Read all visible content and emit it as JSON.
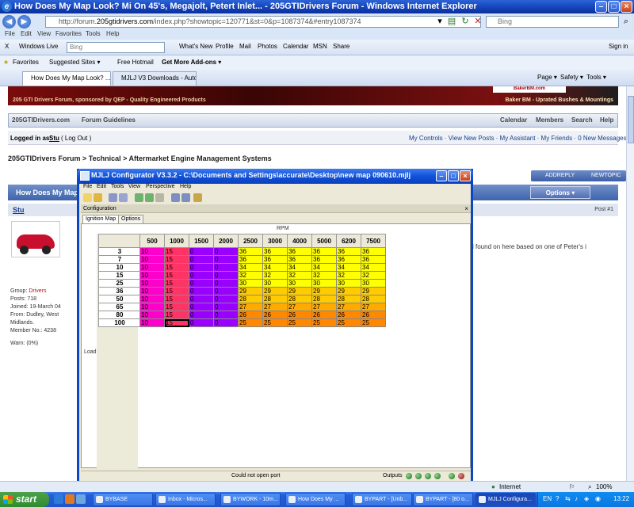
{
  "browser": {
    "title": "How Does My Map Look? Mi On 45's, Megajolt, Petert Inlet... - 205GTIDrivers Forum - Windows Internet Explorer",
    "url_prefix": "http://forum.",
    "url_domain": "205gtidrivers.com",
    "url_rest": "/index.php?showtopic=120771&st=0&p=1087374&#entry1087374",
    "search_placeholder": "Bing",
    "menu": [
      "File",
      "Edit",
      "View",
      "Favorites",
      "Tools",
      "Help"
    ],
    "links_bar": {
      "windows_live": "Windows Live",
      "search_placeholder": "Bing",
      "items": [
        "What's New",
        "Profile",
        "Mail",
        "Photos",
        "Calendar",
        "MSN",
        "Share"
      ],
      "sign_in": "Sign in"
    },
    "favorites_bar": {
      "favorites": "Favorites",
      "items": [
        "Suggested Sites ▾",
        "Free Hotmail",
        "Get More Add-ons ▾"
      ]
    },
    "tabs": [
      {
        "label": "How Does My Map Look? ..."
      },
      {
        "label": "MJLJ V3 Downloads - Autosp..."
      }
    ],
    "command_bar": [
      "Page ▾",
      "Safety ▾",
      "Tools ▾"
    ],
    "status": {
      "zone": "Internet",
      "zoom": "100%"
    }
  },
  "forum": {
    "banner_left": "205 GTI Drivers Forum, sponsored by QEP - Quality Engineered Products",
    "banner_right": "Baker BM - Uprated Bushes & Mountings",
    "banner_brand": "BakerBM.com",
    "nav_left": [
      "205GTIDrivers.com",
      "Forum Guidelines"
    ],
    "nav_right": [
      "Calendar",
      "Members",
      "Search",
      "Help"
    ],
    "login_prefix": "Logged in as:",
    "login_user": "Stu",
    "login_logout": "( Log Out )",
    "login_links": "My Controls · View New Posts · My Assistant · My Friends · 0 New Messages",
    "breadcrumb": "205GTIDrivers Forum > Technical > Aftermarket Engine Management Systems",
    "add_reply": "ADDREPLY",
    "new_topic": "NEWTOPIC",
    "topic_title": "How Does My Map",
    "options": "Options ▾",
    "post_author": "Stu",
    "post_number": "Post #1",
    "post_text": "i found on here based on one of Peter's i",
    "user_info": {
      "group_label": "Group:",
      "group": "Drivers",
      "posts": "Posts: 718",
      "joined": "Joined: 19-March 04",
      "from": "From: Dudley, West Midlands.",
      "member": "Member No.: 4238",
      "warn": "Warn: (0%)"
    }
  },
  "app": {
    "title": "MJLJ Configurator V3.3.2 - C:\\Documents and Settings\\accurate\\Desktop\\new map 090610.mjlj",
    "menu": [
      "File",
      "Edit",
      "Tools",
      "View",
      "Perspective",
      "Help"
    ],
    "panel_title": "Configuration",
    "panel_close": "×",
    "tabs": [
      "Ignition Map",
      "Options"
    ],
    "rpm_label": "RPM",
    "load_label": "Load",
    "status_msg": "Could not open port",
    "outputs_label": "Outputs"
  },
  "colors": {
    "magenta": "#ff00cc",
    "pink": "#ff3366",
    "violet": "#9900ff",
    "yellow": "#ffff00",
    "gold": "#ffcc00",
    "amber": "#ffaa00",
    "orange": "#ff8800"
  },
  "ignition_map": {
    "rpm": [
      "500",
      "1000",
      "1500",
      "2000",
      "2500",
      "3000",
      "4000",
      "5000",
      "6200",
      "7500"
    ],
    "load": [
      "3",
      "7",
      "10",
      "15",
      "25",
      "36",
      "50",
      "65",
      "80",
      "100"
    ],
    "values": [
      [
        "10",
        "15",
        "0",
        "0",
        "36",
        "36",
        "36",
        "36",
        "36",
        "36"
      ],
      [
        "10",
        "15",
        "0",
        "0",
        "36",
        "36",
        "36",
        "36",
        "36",
        "36"
      ],
      [
        "10",
        "15",
        "0",
        "0",
        "34",
        "34",
        "34",
        "34",
        "34",
        "34"
      ],
      [
        "10",
        "15",
        "0",
        "0",
        "32",
        "32",
        "32",
        "32",
        "32",
        "32"
      ],
      [
        "10",
        "15",
        "0",
        "0",
        "30",
        "30",
        "30",
        "30",
        "30",
        "30"
      ],
      [
        "10",
        "15",
        "0",
        "0",
        "29",
        "29",
        "29",
        "29",
        "29",
        "29"
      ],
      [
        "10",
        "15",
        "0",
        "0",
        "28",
        "28",
        "28",
        "28",
        "28",
        "28"
      ],
      [
        "10",
        "15",
        "0",
        "0",
        "27",
        "27",
        "27",
        "27",
        "27",
        "27"
      ],
      [
        "10",
        "15",
        "0",
        "0",
        "26",
        "26",
        "26",
        "26",
        "26",
        "26"
      ],
      [
        "10",
        "15",
        "0",
        "0",
        "25",
        "25",
        "25",
        "25",
        "25",
        "25"
      ]
    ],
    "selected_cell": {
      "row": 9,
      "col": 1
    }
  },
  "taskbar": {
    "start": "start",
    "tasks": [
      {
        "label": "BYBASE",
        "active": false
      },
      {
        "label": "Inbox - Micros...",
        "active": false
      },
      {
        "label": "BYWORK - 10m...",
        "active": false
      },
      {
        "label": "How Does My ...",
        "active": false
      },
      {
        "label": "BYPART - [Unb...",
        "active": false
      },
      {
        "label": "BYPART - [80 o...",
        "active": false
      },
      {
        "label": "MJLJ Configura...",
        "active": true
      }
    ],
    "lang": "EN",
    "clock": "13:22"
  }
}
